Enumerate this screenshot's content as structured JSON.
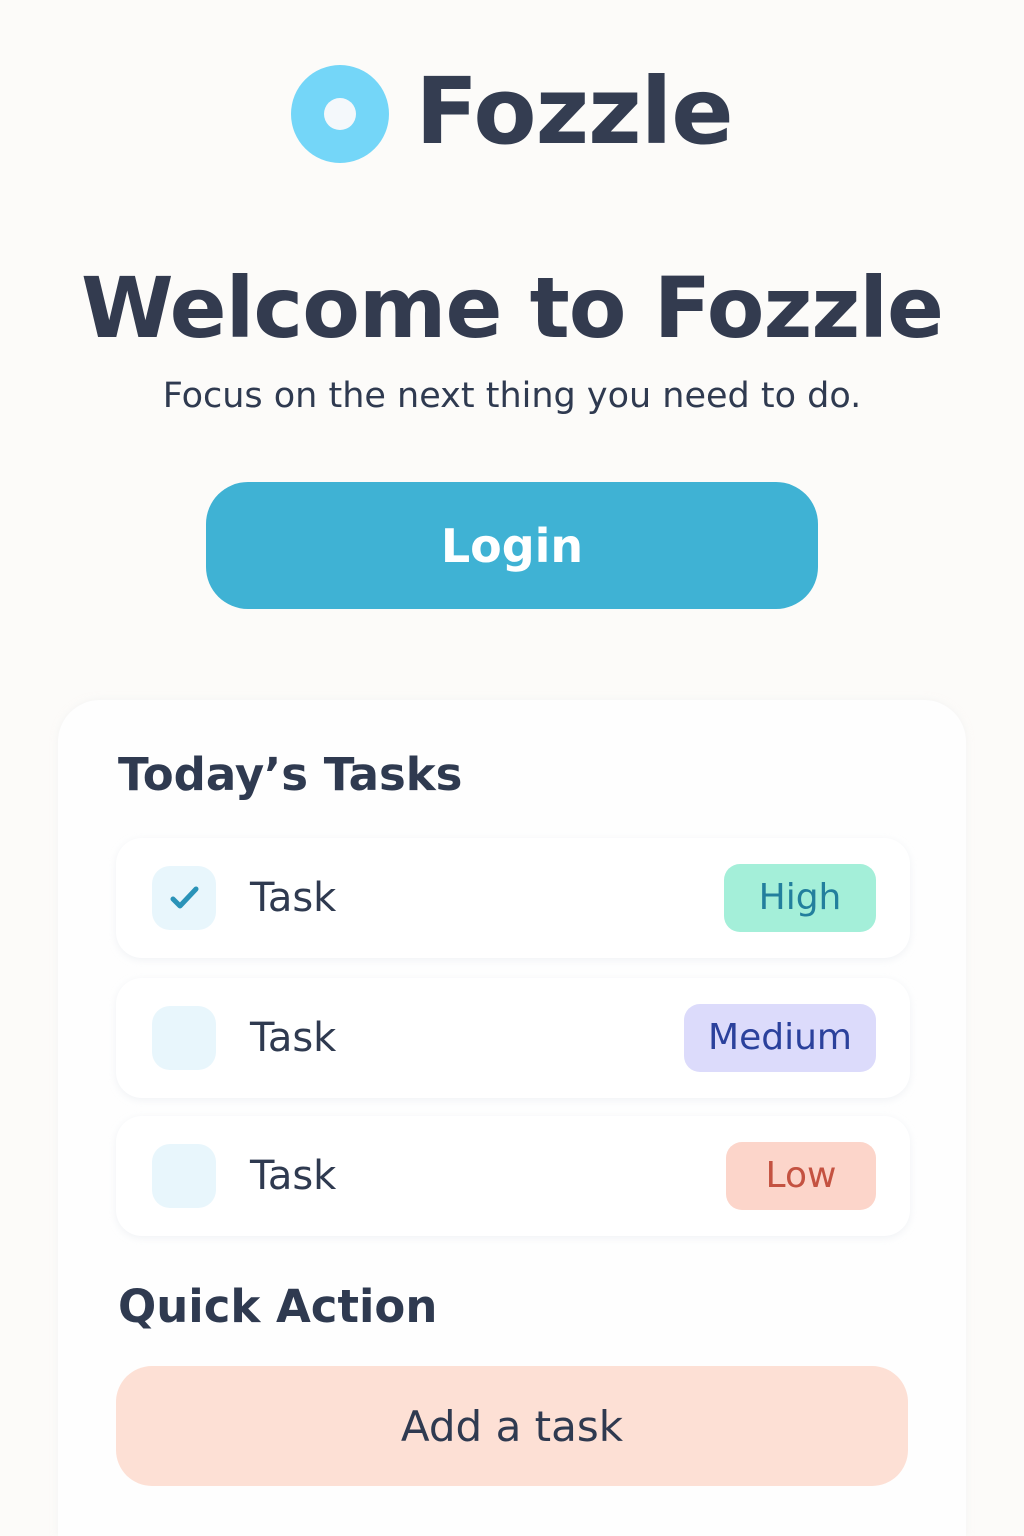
{
  "app": {
    "name": "Fozzle"
  },
  "hero": {
    "title": "Welcome to Fozzle",
    "subtitle": "Focus on the next thing you need to do.",
    "login_label": "Login"
  },
  "tasks": {
    "heading": "Today’s Tasks",
    "items": [
      {
        "label": "Task",
        "checked": true,
        "priority": "High"
      },
      {
        "label": "Task",
        "checked": false,
        "priority": "Medium"
      },
      {
        "label": "Task",
        "checked": false,
        "priority": "Low"
      }
    ]
  },
  "quick_action": {
    "heading": "Quick Action",
    "button_label": "Add a task"
  },
  "icons": {
    "logo": "ring-logo-icon",
    "checkmark": "checkmark-icon"
  },
  "colors": {
    "background": "#fcfbf9",
    "accent": "#3fb2d4",
    "logo": "#74d6f8",
    "text": "#2f3a50",
    "priority_high": "#a4efd9",
    "priority_medium": "#dcdbfb",
    "priority_low": "#fcd5ca",
    "quick_action": "#fde0d5"
  }
}
